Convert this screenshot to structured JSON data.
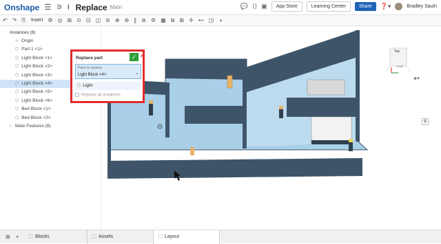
{
  "topbar": {
    "logo": "Onshape",
    "menu_icon": "hamburger-icon",
    "doc_title": "Replace",
    "branch": "Main",
    "app_store_label": "App Store",
    "learning_center_label": "Learning Center",
    "share_label": "Share",
    "username": "Bradley Sauln"
  },
  "toolbar": {
    "insert_label": "Insert"
  },
  "sidebar": {
    "heading": "Instances (8)",
    "items": [
      {
        "label": "Origin",
        "icon": "origin-icon"
      },
      {
        "label": "Part 1 <1>",
        "icon": "part-icon"
      },
      {
        "label": "Light Block <1>",
        "icon": "part-icon"
      },
      {
        "label": "Light Block <2>",
        "icon": "part-icon"
      },
      {
        "label": "Light Block <3>",
        "icon": "part-icon"
      },
      {
        "label": "Light Block <4>",
        "icon": "part-icon",
        "selected": true
      },
      {
        "label": "Light Block <5>",
        "icon": "part-icon"
      },
      {
        "label": "Light Block <6>",
        "icon": "part-icon"
      },
      {
        "label": "Bed Block <1>",
        "icon": "part-icon"
      },
      {
        "label": "Bed Block <2>",
        "icon": "part-icon"
      }
    ],
    "mate_features": "Mate Features (8)"
  },
  "dialog": {
    "title": "Replace part",
    "parts_label": "Parts to replace",
    "parts_value": "Light Block <4>",
    "replacement": "Light",
    "replace_all": "Replace all instances"
  },
  "viewcube": {
    "face_label": "Top",
    "front_label": "Front"
  },
  "tabs": [
    {
      "label": "Blocks",
      "active": false
    },
    {
      "label": "Assets",
      "active": false
    },
    {
      "label": "Layout",
      "active": true
    }
  ],
  "colors": {
    "accent": "#1e63b6",
    "selection": "#cfe3f7",
    "dialog_border": "#e02a2a",
    "wall": "#3e5569",
    "floor": "#a9cfe9"
  }
}
